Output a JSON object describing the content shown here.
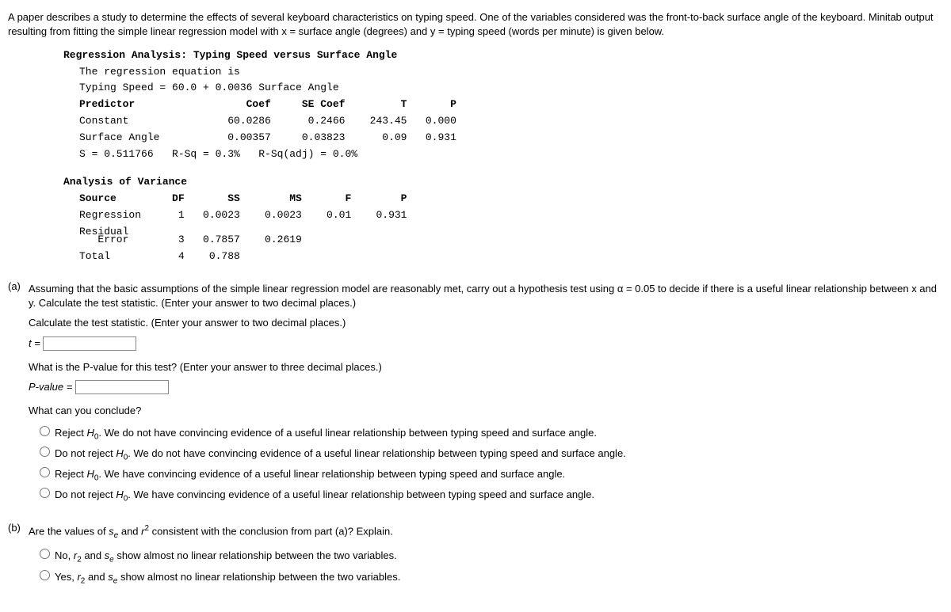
{
  "intro": "A paper describes a study to determine the effects of several keyboard characteristics on typing speed. One of the variables considered was the front-to-back surface angle of the keyboard. Minitab output resulting from fitting the simple linear regression model with x = surface angle (degrees) and y = typing speed (words per minute) is given below.",
  "regression": {
    "title": "Regression Analysis: Typing Speed versus Surface Angle",
    "eq_line1": "The regression equation is",
    "eq_line2": "Typing Speed = 60.0 + 0.0036 Surface Angle",
    "pred_header": "Predictor                  Coef     SE Coef         T       P",
    "pred_row1": "Constant                60.0286      0.2466    243.45   0.000",
    "pred_row2": "Surface Angle           0.00357     0.03823      0.09   0.931",
    "s_line": "S = 0.511766   R-Sq = 0.3%   R-Sq(adj) = 0.0%"
  },
  "anova": {
    "title": "Analysis of Variance",
    "header": "Source         DF       SS        MS       F        P",
    "row1": "Regression      1   0.0023    0.0023    0.01    0.931",
    "row2a": "Residual",
    "row2b": "   Error        3   0.7857    0.2619",
    "row3": "Total           4    0.788"
  },
  "partA": {
    "label": "(a)",
    "q1": "Assuming that the basic assumptions of the simple linear regression model are reasonably met, carry out a hypothesis test using α = 0.05 to decide if there is a useful linear relationship between x and y. Calculate the test statistic. (Enter your answer to two decimal places.)",
    "q2": "Calculate the test statistic. (Enter your answer to two decimal places.)",
    "t_label": "t = ",
    "q3": "What is the P-value for this test? (Enter your answer to three decimal places.)",
    "p_label": "P-value = ",
    "q4": "What can you conclude?",
    "opt1_a": "Reject ",
    "opt1_b": ". We do not have convincing evidence of a useful linear relationship between typing speed and surface angle.",
    "opt2_a": "Do not reject ",
    "opt2_b": ". We do not have convincing evidence of a useful linear relationship between typing speed and surface angle.",
    "opt3_a": "Reject ",
    "opt3_b": ". We have convincing evidence of a useful linear relationship between typing speed and surface angle.",
    "opt4_a": "Do not reject ",
    "opt4_b": ". We have convincing evidence of a useful linear relationship between typing speed and surface angle."
  },
  "partB": {
    "label": "(b)",
    "q1_a": "Are the values of ",
    "q1_b": " and ",
    "q1_c": " consistent with the conclusion from part (a)? Explain.",
    "opt1_a": "No, ",
    "opt1_b": " and ",
    "opt1_c": " show almost no linear relationship between the two variables.",
    "opt2_a": "Yes, ",
    "opt2_b": " and ",
    "opt2_c": " show almost no linear relationship between the two variables."
  }
}
